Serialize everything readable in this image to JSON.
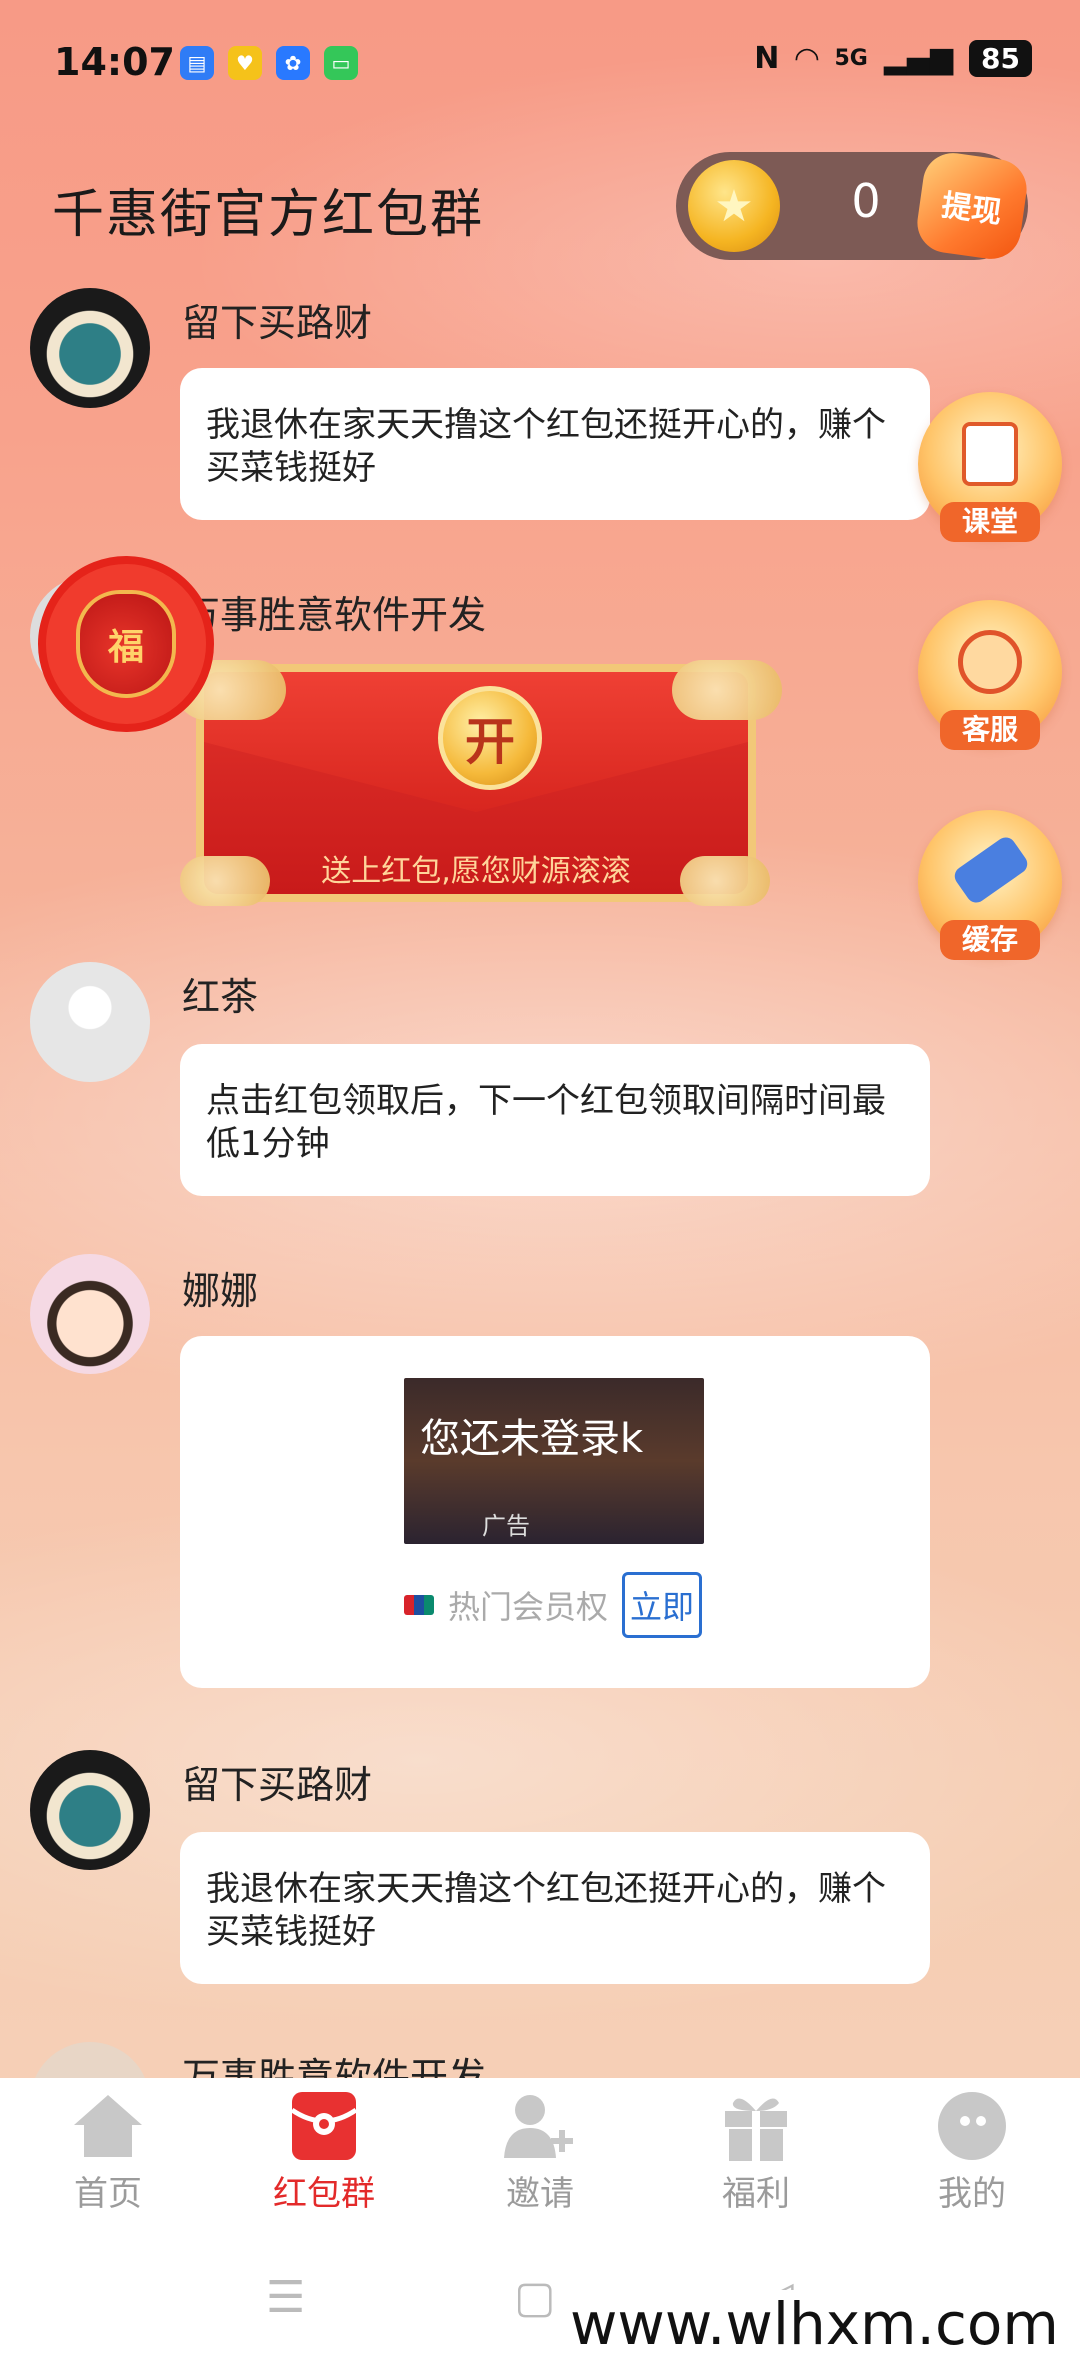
{
  "status_bar": {
    "time": "14:07",
    "signal": "5G",
    "battery": "85"
  },
  "header": {
    "title": "千惠街官方红包群",
    "coins": "0",
    "withdraw_label": "提现"
  },
  "side_buttons": [
    {
      "label": "课堂",
      "icon": "notepad-icon"
    },
    {
      "label": "客服",
      "icon": "headset-icon"
    },
    {
      "label": "缓存",
      "icon": "broom-icon"
    }
  ],
  "messages": [
    {
      "name": "留下买路财",
      "text": "我退休在家天天撸这个红包还挺开心的，赚个买菜钱挺好"
    },
    {
      "name": "万事胜意软件开发",
      "packet_open": "开",
      "packet_text": "送上红包,愿您财源滚滚"
    },
    {
      "name": "红茶",
      "text": "点击红包领取后，下一个红包领取间隔时间最低1分钟"
    },
    {
      "name": "娜娜",
      "ad_title": "您还未登录k",
      "ad_tag": "广告",
      "ad_text": "热门会员权",
      "ad_button": "立即"
    },
    {
      "name": "留下买路财",
      "text": "我退休在家天天撸这个红包还挺开心的，赚个买菜钱挺好"
    },
    {
      "name": "万事胜意软件开发"
    }
  ],
  "floating": {
    "fudai_label": "福"
  },
  "tabs": [
    {
      "label": "首页",
      "icon": "home-icon"
    },
    {
      "label": "红包群",
      "icon": "red-packet-icon"
    },
    {
      "label": "邀请",
      "icon": "add-user-icon"
    },
    {
      "label": "福利",
      "icon": "gift-icon"
    },
    {
      "label": "我的",
      "icon": "profile-icon"
    }
  ],
  "watermark": "www.wlhxm.com",
  "colors": {
    "accent_red": "#e32a2a",
    "tab_inactive": "#9b9b9b",
    "coin_bar": "#7d5a55"
  }
}
